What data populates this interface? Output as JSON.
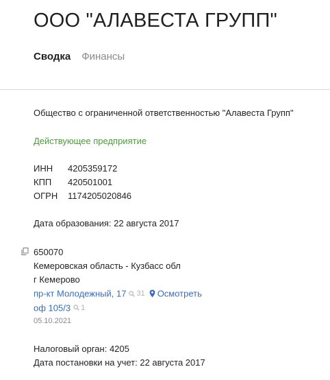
{
  "company": {
    "title": "ООО \"АЛАВЕСТА ГРУПП\"",
    "full_name": "Общество с ограниченной ответственностью \"Алавеста Групп\"",
    "status": "Действующее предприятие"
  },
  "tabs": [
    {
      "label": "Сводка",
      "active": true
    },
    {
      "label": "Финансы",
      "active": false
    }
  ],
  "codes": [
    {
      "label": "ИНН",
      "value": "4205359172"
    },
    {
      "label": "КПП",
      "value": "420501001"
    },
    {
      "label": "ОГРН",
      "value": "1174205020846"
    }
  ],
  "registration_date": "Дата образования: 22 августа 2017",
  "address": {
    "postal_code": "650070",
    "region": "Кемеровская область - Кузбасс обл",
    "city": "г Кемерово",
    "street_link": "пр-кт Молодежный, 17",
    "street_count": "31",
    "view_link": "Осмотреть",
    "office_link": "оф 105/3",
    "office_count": "1",
    "updated": "05.10.2021"
  },
  "tax": {
    "authority": "Налоговый орган: 4205",
    "registration": "Дата постановки на учет: 22 августа 2017"
  },
  "colors": {
    "status_green": "#4f9a3e",
    "link_blue": "#3a6db3",
    "muted": "#8a8a8a"
  },
  "icons": {
    "copy": "copy-icon",
    "search": "search-icon",
    "pin": "map-pin-icon"
  }
}
